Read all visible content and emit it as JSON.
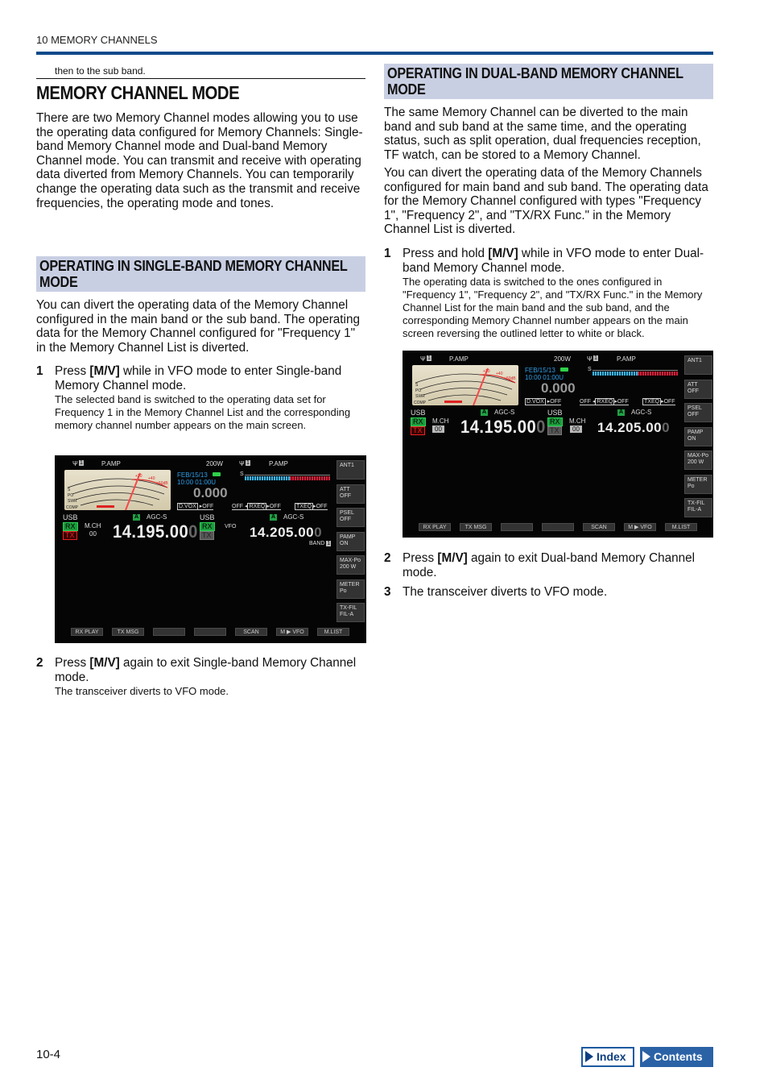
{
  "header": {
    "chapter": "10 MEMORY CHANNELS",
    "continued_text": "then to the sub band."
  },
  "main": {
    "title": "MEMORY CHANNEL MODE",
    "intro": "There are two Memory Channel modes allowing you to use the operating data configured for Memory Channels: Single-band Memory Channel mode and Dual-band Memory Channel mode. You can transmit and receive with operating data diverted from Memory Channels. You can temporarily change the operating data such as the transmit and receive frequencies, the operating mode and tones."
  },
  "single_band": {
    "heading": "OPERATING IN SINGLE-BAND MEMORY CHANNEL MODE",
    "intro": "You can divert the operating data of the Memory Channel configured in the main band or the sub band. The operating data for the Memory Channel configured for \"Frequency 1\" in the Memory Channel List is diverted.",
    "steps": [
      {
        "num": "1",
        "pre": "Press ",
        "key": "[M/V]",
        "post": " while in VFO mode to enter Single-band Memory Channel mode.",
        "sub": "The selected band is switched to the operating data set for Frequency 1 in the Memory Channel List and the corresponding memory channel number appears on the main screen."
      },
      {
        "num": "2",
        "pre": "Press ",
        "key": "[M/V]",
        "post": " again to exit Single-band Memory Channel mode.",
        "sub": "The transceiver diverts to VFO mode."
      }
    ],
    "screen": {
      "ant_label": "1",
      "pamp_left": "P.AMP",
      "power": "200W",
      "pamp_right": "P.AMP",
      "ant_right": "1",
      "date": "FEB/15/13",
      "time": "10:00 01:00U",
      "offset": "0.000",
      "dvox": "D.VOX",
      "dvox_state": "OFF",
      "rxeq_pre": "OFF",
      "rxeq": "RXEQ",
      "rxeq_state": "OFF",
      "txeq": "TXEQ",
      "txeq_state": "OFF",
      "main_mode": "USB",
      "main_agc": "AGC-S",
      "main_freq": "14.195.00",
      "main_freq_dim": "0",
      "mch_label": "M.CH",
      "mch_num": "00",
      "sub_mode": "USB",
      "sub_tag": "VFO",
      "sub_agc": "AGC-S",
      "sub_freq": "14.205.00",
      "sub_freq_dim": "0",
      "band_label": "BAND",
      "band_num": "1",
      "rx": "RX",
      "tx": "TX",
      "a_badge": "A",
      "side_buttons": [
        [
          "ANT1",
          ""
        ],
        [
          "ATT",
          "OFF"
        ],
        [
          "PSEL",
          "OFF"
        ],
        [
          "PAMP",
          "ON"
        ],
        [
          "MAX-Po",
          "200 W"
        ],
        [
          "METER",
          "Po"
        ],
        [
          "TX-FIL",
          "FIL-A"
        ]
      ],
      "bottom_buttons": [
        "RX PLAY",
        "TX MSG",
        "",
        "",
        "SCAN",
        "M ▶ VFO",
        "M.LIST"
      ]
    }
  },
  "dual_band": {
    "heading": "OPERATING IN DUAL-BAND MEMORY CHANNEL MODE",
    "intro1": "The same Memory Channel can be diverted to the main band and sub band at the same time, and the operating status, such as split operation, dual frequencies reception, TF watch, can be stored to a Memory Channel.",
    "intro2": "You can divert the operating data of the Memory Channels configured for main band and sub band. The operating data for the Memory Channel configured with types \"Frequency 1\", \"Frequency 2\", and \"TX/RX Func.\" in the Memory Channel List is diverted.",
    "steps": [
      {
        "num": "1",
        "pre": "Press and hold ",
        "key": "[M/V]",
        "post": " while in VFO mode to enter Dual-band Memory Channel mode.",
        "sub": "The operating data is switched to the ones configured in \"Frequency 1\", \"Frequency 2\", and \"TX/RX Func.\" in the Memory Channel List for the main band and the sub band, and the corresponding Memory Channel number appears on the main screen reversing the outlined letter to white or black."
      },
      {
        "num": "2",
        "pre": "Press ",
        "key": "[M/V]",
        "post": " again to exit Dual-band Memory Channel mode.",
        "sub": ""
      },
      {
        "num": "3",
        "pre": "The transceiver diverts to VFO mode.",
        "key": "",
        "post": "",
        "sub": ""
      }
    ],
    "screen": {
      "ant_label": "1",
      "pamp_left": "P.AMP",
      "power": "200W",
      "pamp_right": "P.AMP",
      "ant_right": "1",
      "date": "FEB/15/13",
      "time": "10:00 01:00U",
      "offset": "0.000",
      "dvox": "D.VOX",
      "dvox_state": "OFF",
      "rxeq_pre": "OFF",
      "rxeq": "RXEQ",
      "rxeq_state": "OFF",
      "txeq": "TXEQ",
      "txeq_state": "OFF",
      "main_mode": "USB",
      "main_agc": "AGC-S",
      "main_freq": "14.195.00",
      "main_freq_dim": "0",
      "mch_label": "M.CH",
      "mch_num": "00",
      "sub_mode": "USB",
      "sub_agc": "AGC-S",
      "sub_freq": "14.205.00",
      "sub_freq_dim": "0",
      "sub_mch_label": "M.CH",
      "sub_mch_num": "00",
      "rx": "RX",
      "tx": "TX",
      "a_badge": "A",
      "side_buttons": [
        [
          "ANT1",
          ""
        ],
        [
          "ATT",
          "OFF"
        ],
        [
          "PSEL",
          "OFF"
        ],
        [
          "PAMP",
          "ON"
        ],
        [
          "MAX-Po",
          "200 W"
        ],
        [
          "METER",
          "Po"
        ],
        [
          "TX-FIL",
          "FIL-A"
        ]
      ],
      "bottom_buttons": [
        "RX PLAY",
        "TX MSG",
        "",
        "",
        "SCAN",
        "M ▶ VFO",
        "M.LIST"
      ]
    }
  },
  "footer": {
    "page": "10-4",
    "index_label": "Index",
    "contents_label": "Contents"
  },
  "colors": {
    "accent_blue": "#0e4a8a",
    "heading_bg": "#c9cfe3",
    "screen_bg": "#050505",
    "rx_green": "#1c9a3c",
    "tx_red": "#e22222"
  }
}
